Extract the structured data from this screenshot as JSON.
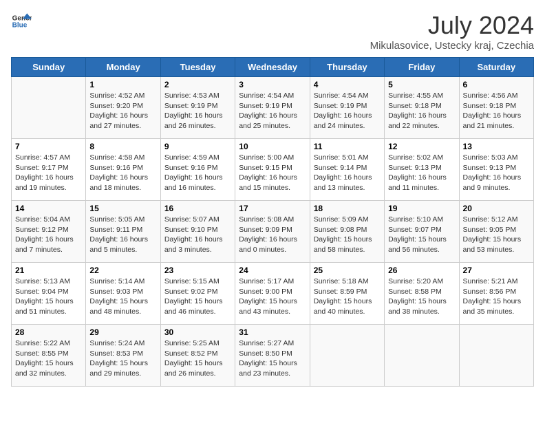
{
  "header": {
    "logo_general": "General",
    "logo_blue": "Blue",
    "month_title": "July 2024",
    "location": "Mikulasovice, Ustecky kraj, Czechia"
  },
  "days_of_week": [
    "Sunday",
    "Monday",
    "Tuesday",
    "Wednesday",
    "Thursday",
    "Friday",
    "Saturday"
  ],
  "weeks": [
    [
      {
        "day": "",
        "info": ""
      },
      {
        "day": "1",
        "info": "Sunrise: 4:52 AM\nSunset: 9:20 PM\nDaylight: 16 hours\nand 27 minutes."
      },
      {
        "day": "2",
        "info": "Sunrise: 4:53 AM\nSunset: 9:19 PM\nDaylight: 16 hours\nand 26 minutes."
      },
      {
        "day": "3",
        "info": "Sunrise: 4:54 AM\nSunset: 9:19 PM\nDaylight: 16 hours\nand 25 minutes."
      },
      {
        "day": "4",
        "info": "Sunrise: 4:54 AM\nSunset: 9:19 PM\nDaylight: 16 hours\nand 24 minutes."
      },
      {
        "day": "5",
        "info": "Sunrise: 4:55 AM\nSunset: 9:18 PM\nDaylight: 16 hours\nand 22 minutes."
      },
      {
        "day": "6",
        "info": "Sunrise: 4:56 AM\nSunset: 9:18 PM\nDaylight: 16 hours\nand 21 minutes."
      }
    ],
    [
      {
        "day": "7",
        "info": "Sunrise: 4:57 AM\nSunset: 9:17 PM\nDaylight: 16 hours\nand 19 minutes."
      },
      {
        "day": "8",
        "info": "Sunrise: 4:58 AM\nSunset: 9:16 PM\nDaylight: 16 hours\nand 18 minutes."
      },
      {
        "day": "9",
        "info": "Sunrise: 4:59 AM\nSunset: 9:16 PM\nDaylight: 16 hours\nand 16 minutes."
      },
      {
        "day": "10",
        "info": "Sunrise: 5:00 AM\nSunset: 9:15 PM\nDaylight: 16 hours\nand 15 minutes."
      },
      {
        "day": "11",
        "info": "Sunrise: 5:01 AM\nSunset: 9:14 PM\nDaylight: 16 hours\nand 13 minutes."
      },
      {
        "day": "12",
        "info": "Sunrise: 5:02 AM\nSunset: 9:13 PM\nDaylight: 16 hours\nand 11 minutes."
      },
      {
        "day": "13",
        "info": "Sunrise: 5:03 AM\nSunset: 9:13 PM\nDaylight: 16 hours\nand 9 minutes."
      }
    ],
    [
      {
        "day": "14",
        "info": "Sunrise: 5:04 AM\nSunset: 9:12 PM\nDaylight: 16 hours\nand 7 minutes."
      },
      {
        "day": "15",
        "info": "Sunrise: 5:05 AM\nSunset: 9:11 PM\nDaylight: 16 hours\nand 5 minutes."
      },
      {
        "day": "16",
        "info": "Sunrise: 5:07 AM\nSunset: 9:10 PM\nDaylight: 16 hours\nand 3 minutes."
      },
      {
        "day": "17",
        "info": "Sunrise: 5:08 AM\nSunset: 9:09 PM\nDaylight: 16 hours\nand 0 minutes."
      },
      {
        "day": "18",
        "info": "Sunrise: 5:09 AM\nSunset: 9:08 PM\nDaylight: 15 hours\nand 58 minutes."
      },
      {
        "day": "19",
        "info": "Sunrise: 5:10 AM\nSunset: 9:07 PM\nDaylight: 15 hours\nand 56 minutes."
      },
      {
        "day": "20",
        "info": "Sunrise: 5:12 AM\nSunset: 9:05 PM\nDaylight: 15 hours\nand 53 minutes."
      }
    ],
    [
      {
        "day": "21",
        "info": "Sunrise: 5:13 AM\nSunset: 9:04 PM\nDaylight: 15 hours\nand 51 minutes."
      },
      {
        "day": "22",
        "info": "Sunrise: 5:14 AM\nSunset: 9:03 PM\nDaylight: 15 hours\nand 48 minutes."
      },
      {
        "day": "23",
        "info": "Sunrise: 5:15 AM\nSunset: 9:02 PM\nDaylight: 15 hours\nand 46 minutes."
      },
      {
        "day": "24",
        "info": "Sunrise: 5:17 AM\nSunset: 9:00 PM\nDaylight: 15 hours\nand 43 minutes."
      },
      {
        "day": "25",
        "info": "Sunrise: 5:18 AM\nSunset: 8:59 PM\nDaylight: 15 hours\nand 40 minutes."
      },
      {
        "day": "26",
        "info": "Sunrise: 5:20 AM\nSunset: 8:58 PM\nDaylight: 15 hours\nand 38 minutes."
      },
      {
        "day": "27",
        "info": "Sunrise: 5:21 AM\nSunset: 8:56 PM\nDaylight: 15 hours\nand 35 minutes."
      }
    ],
    [
      {
        "day": "28",
        "info": "Sunrise: 5:22 AM\nSunset: 8:55 PM\nDaylight: 15 hours\nand 32 minutes."
      },
      {
        "day": "29",
        "info": "Sunrise: 5:24 AM\nSunset: 8:53 PM\nDaylight: 15 hours\nand 29 minutes."
      },
      {
        "day": "30",
        "info": "Sunrise: 5:25 AM\nSunset: 8:52 PM\nDaylight: 15 hours\nand 26 minutes."
      },
      {
        "day": "31",
        "info": "Sunrise: 5:27 AM\nSunset: 8:50 PM\nDaylight: 15 hours\nand 23 minutes."
      },
      {
        "day": "",
        "info": ""
      },
      {
        "day": "",
        "info": ""
      },
      {
        "day": "",
        "info": ""
      }
    ]
  ]
}
